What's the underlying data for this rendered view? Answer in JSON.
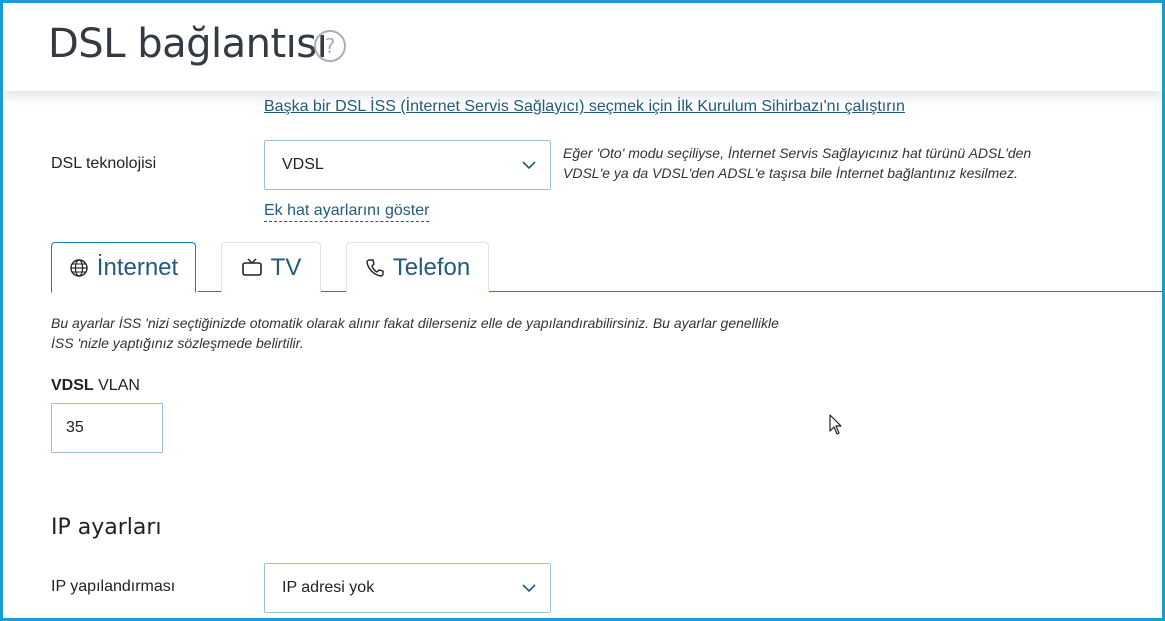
{
  "header": {
    "title": "DSL bağlantısı",
    "help_icon": "help-circle-icon"
  },
  "wizard_link": "Başka bir DSL İSS (İnternet Servis Sağlayıcı) seçmek için İlk Kurulum Sihirbazı'nı çalıştırın",
  "dsl_technology": {
    "label": "DSL teknolojisi",
    "value": "VDSL",
    "hint_line1": "Eğer 'Oto' modu seçiliyse, İnternet Servis Sağlayıcınız hat türünü ADSL'den",
    "hint_line2": "VDSL'e ya da VDSL'den ADSL'e taşısa bile İnternet bağlantınız kesilmez."
  },
  "extra_link": "Ek hat ayarlarını göster",
  "tabs": [
    {
      "label": "İnternet",
      "icon": "globe-icon",
      "active": true
    },
    {
      "label": "TV",
      "icon": "tv-icon",
      "active": false
    },
    {
      "label": "Telefon",
      "icon": "phone-icon",
      "active": false
    }
  ],
  "tab_description_line1": "Bu ayarlar İSS 'nizi seçtiğinizde otomatik olarak alınır fakat dilerseniz elle de yapılandırabilirsiniz. Bu ayarlar genellikle",
  "tab_description_line2": "İSS 'nizle yaptığınız sözleşmede belirtilir.",
  "vlan": {
    "label_bold": "VDSL",
    "label_rest": " VLAN",
    "value": "35"
  },
  "ip_section": {
    "title": "IP ayarları",
    "config_label": "IP yapılandırması",
    "config_value": "IP adresi yok"
  },
  "colors": {
    "accent": "#1b9ad6",
    "link": "#245a7c",
    "input_border": "#9cc1d6"
  }
}
